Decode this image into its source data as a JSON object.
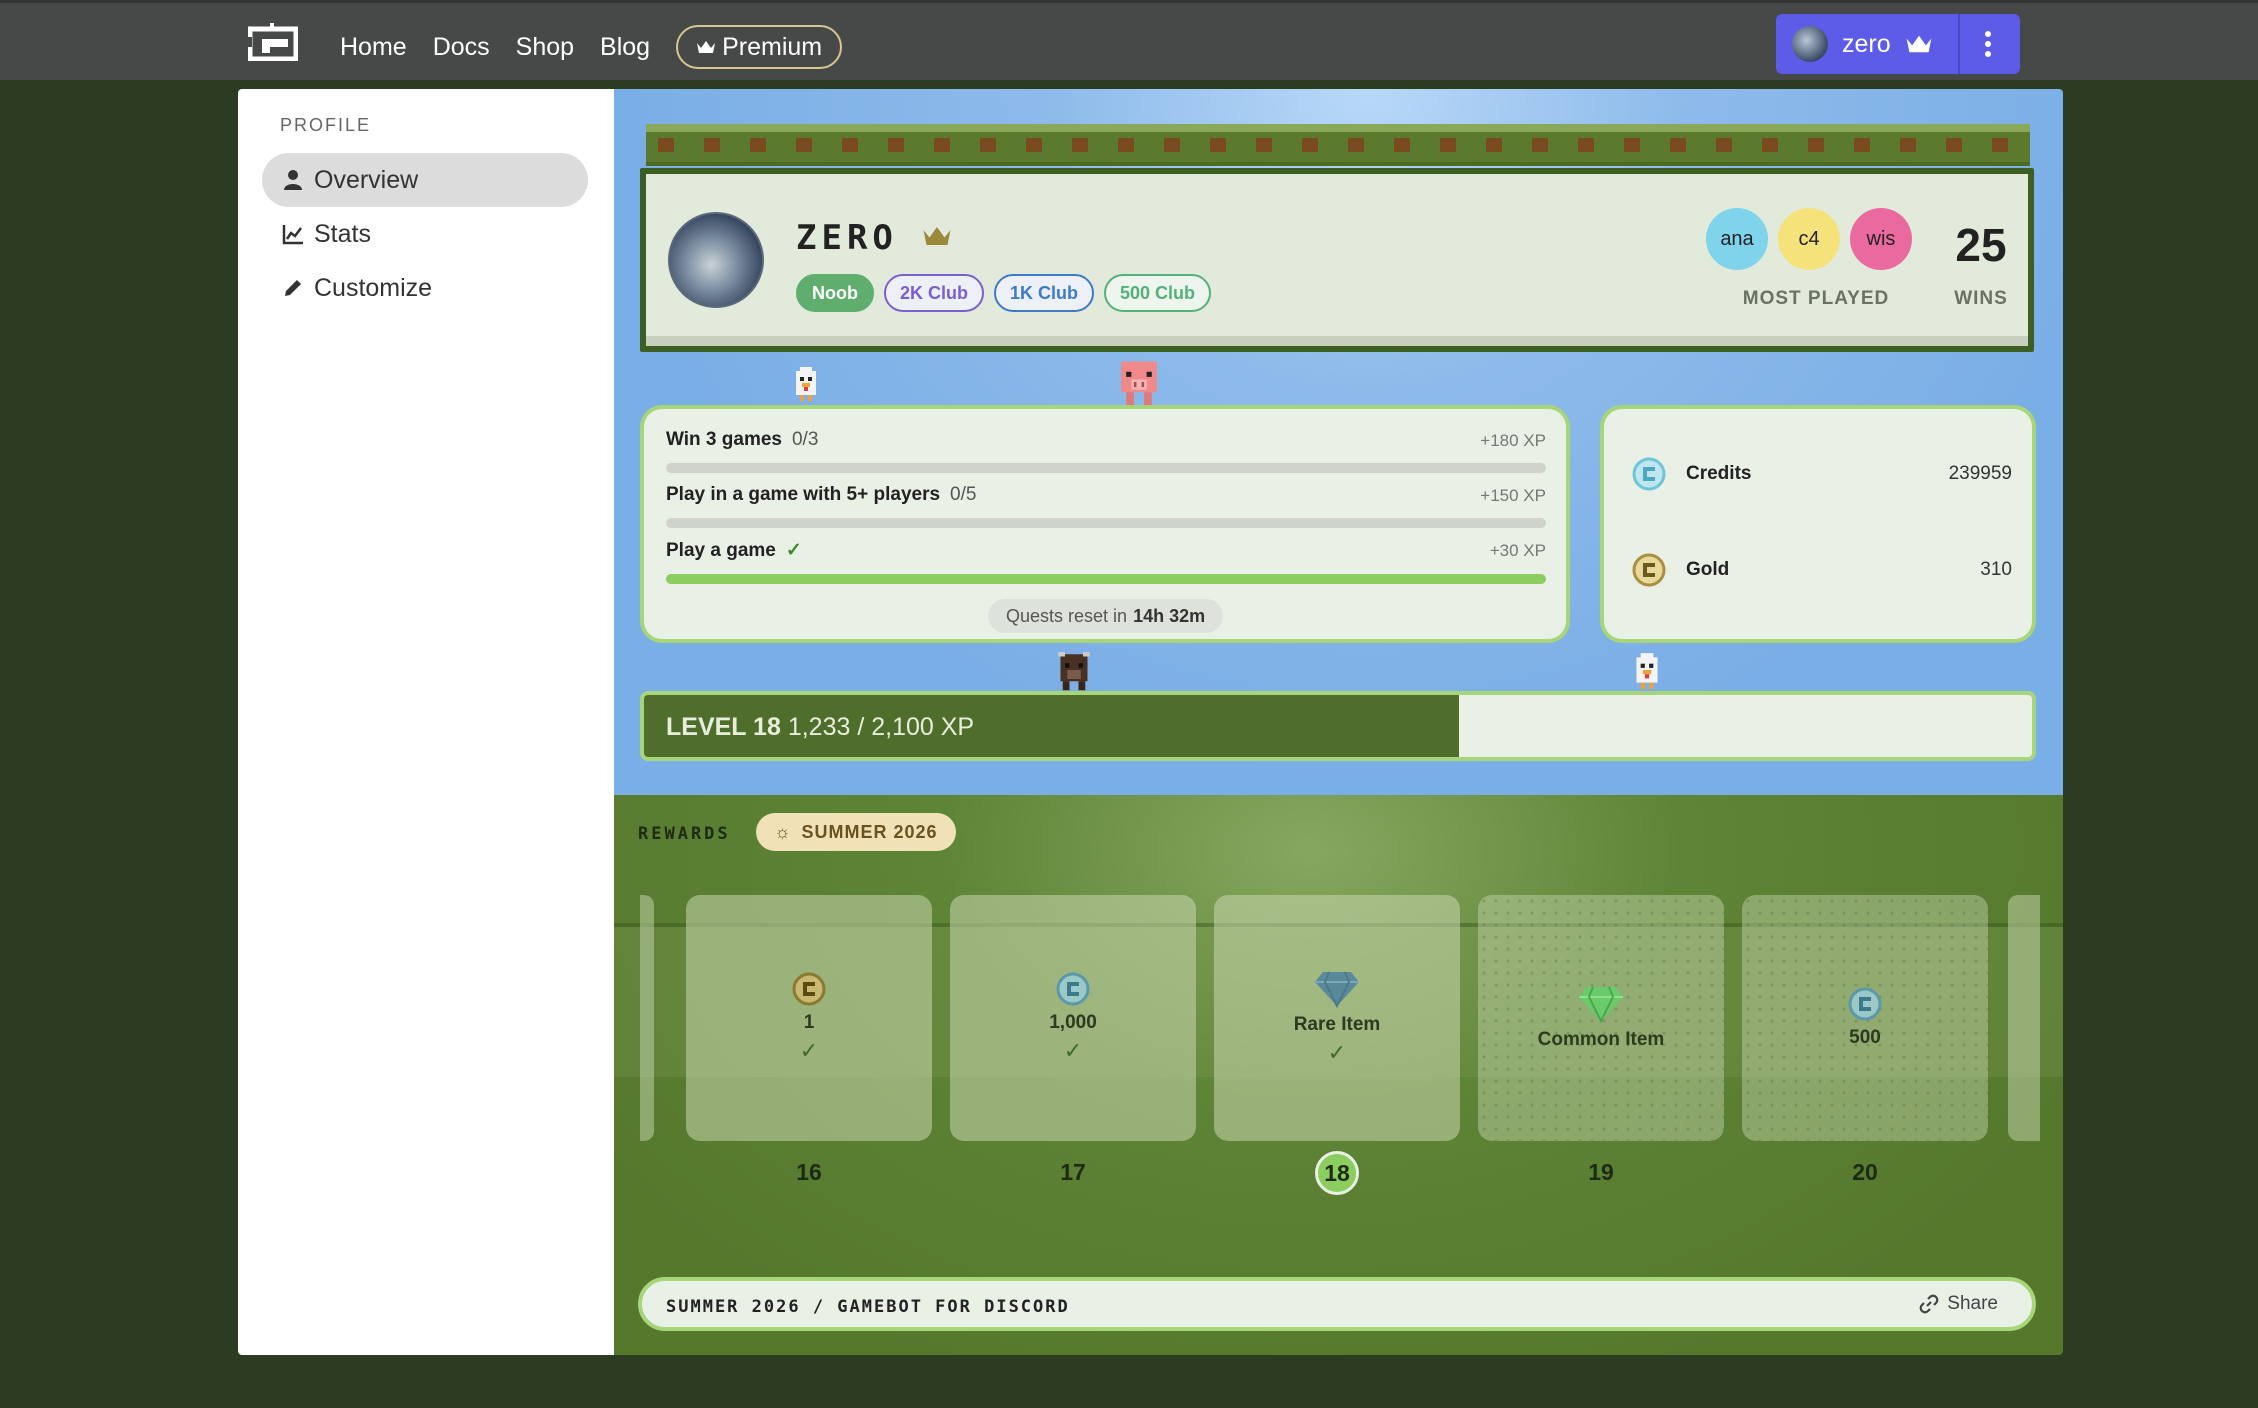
{
  "nav": {
    "links": [
      "Home",
      "Docs",
      "Shop",
      "Blog"
    ],
    "premium_label": "Premium"
  },
  "user": {
    "name": "zero"
  },
  "sidebar": {
    "title": "PROFILE",
    "items": [
      {
        "label": "Overview",
        "icon": "user-icon",
        "active": true
      },
      {
        "label": "Stats",
        "icon": "chart-icon",
        "active": false
      },
      {
        "label": "Customize",
        "icon": "pencil-icon",
        "active": false
      }
    ]
  },
  "profile": {
    "name": "ZERO",
    "badges": [
      "Noob",
      "2K Club",
      "1K Club",
      "500 Club"
    ],
    "most_played": [
      "ana",
      "c4",
      "wis"
    ],
    "most_played_label": "MOST PLAYED",
    "wins": "25",
    "wins_label": "WINS"
  },
  "quests": {
    "items": [
      {
        "title": "Win 3 games",
        "progress": "0/3",
        "xp": "+180 XP",
        "done": false,
        "fraction": 0
      },
      {
        "title": "Play in a game with 5+ players",
        "progress": "0/5",
        "xp": "+150 XP",
        "done": false,
        "fraction": 0
      },
      {
        "title": "Play a game",
        "progress": "✓",
        "xp": "+30 XP",
        "done": true,
        "fraction": 1
      }
    ],
    "reset_prefix": "Quests reset in",
    "reset_time": "14h 32m"
  },
  "currency": {
    "credits_label": "Credits",
    "credits_value": "239959",
    "gold_label": "Gold",
    "gold_value": "310"
  },
  "level": {
    "label": "LEVEL 18",
    "xp_text": "1,233 / 2,100 XP",
    "fraction": 0.587
  },
  "rewards": {
    "title": "REWARDS",
    "season": "SUMMER 2026",
    "items": [
      {
        "label": "1",
        "icon": "gold-coin-icon",
        "claimed": true,
        "level": "16"
      },
      {
        "label": "1,000",
        "icon": "credit-coin-icon",
        "claimed": true,
        "level": "17"
      },
      {
        "label": "Rare Item",
        "icon": "blue-gem-icon",
        "claimed": true,
        "level": "18"
      },
      {
        "label": "Common Item",
        "icon": "green-gem-icon",
        "claimed": false,
        "level": "19"
      },
      {
        "label": "500",
        "icon": "credit-coin-icon",
        "claimed": false,
        "level": "20"
      }
    ],
    "check": "✓"
  },
  "footer": {
    "text": "SUMMER 2026 / GAMEBOT FOR DISCORD",
    "share_label": "Share"
  },
  "colors": {
    "accent": "#5c5ce8",
    "progress_green": "#8bcd5e",
    "level_fill": "#4f6e2b",
    "ana": "#7fd3ea",
    "c4": "#f6e27a",
    "wis": "#ea6aa0"
  }
}
